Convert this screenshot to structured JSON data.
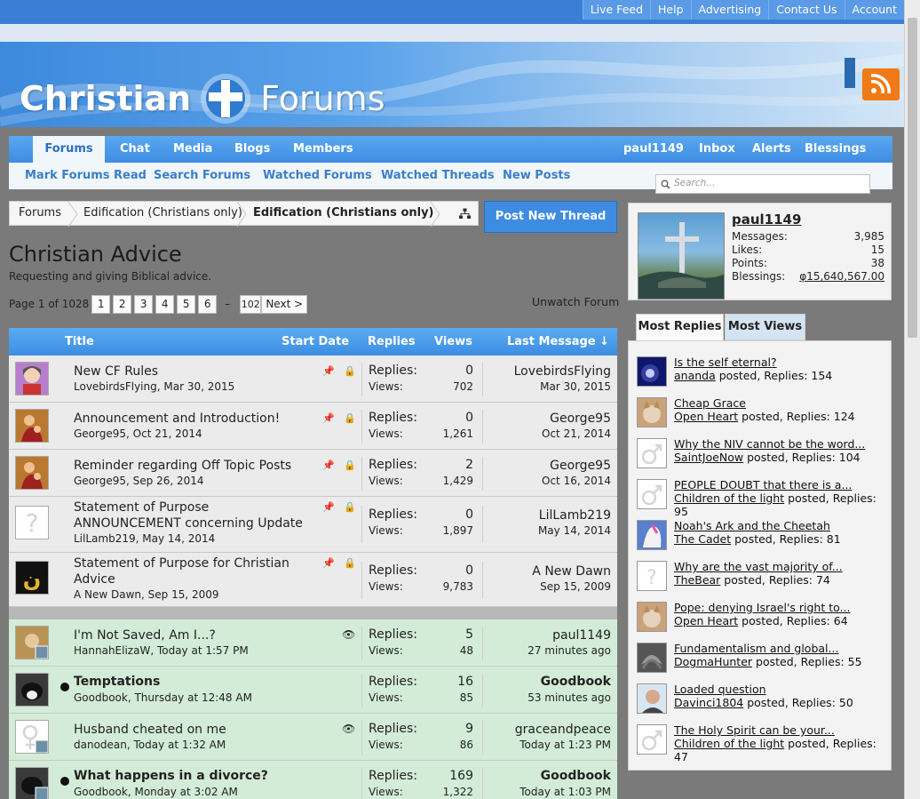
{
  "top_links": [
    "Live Feed",
    "Help",
    "Advertising",
    "Contact Us",
    "Account"
  ],
  "logo": {
    "word1": "Christian",
    "word2": "Forums"
  },
  "nav": {
    "tabs": [
      "Forums",
      "Chat",
      "Media",
      "Blogs",
      "Members"
    ],
    "user_links": [
      "paul1149",
      "Inbox",
      "Alerts",
      "Blessings"
    ]
  },
  "subnav": [
    "Mark Forums Read",
    "Search Forums",
    "Watched Forums",
    "Watched Threads",
    "New Posts"
  ],
  "search_placeholder": "Search...",
  "breadcrumb": [
    "Forums",
    "Edification (Christians only)",
    "Edification (Christians only)"
  ],
  "post_button": "Post New Thread",
  "forum": {
    "title": "Christian Advice",
    "description": "Requesting and giving Biblical advice."
  },
  "pager": {
    "label": "Page 1 of 1028",
    "pages": [
      "1",
      "2",
      "3",
      "4",
      "5",
      "6"
    ],
    "ellipsis": "–",
    "last": "102",
    "next": "Next >"
  },
  "unwatch": "Unwatch Forum",
  "table_header": {
    "title": "Title",
    "start_date": "Start Date",
    "replies": "Replies",
    "views": "Views",
    "last_message": "Last Message ↓"
  },
  "threads": [
    {
      "title": "New CF Rules",
      "starter": "LovebirdsFlying, Mar 30, 2015",
      "replies_label": "Replies:",
      "replies": "0",
      "views_label": "Views:",
      "views": "702",
      "last_user": "LovebirdsFlying",
      "last_date": "Mar 30, 2015"
    },
    {
      "title": "Announcement and Introduction!",
      "starter": "George95, Oct 21, 2014",
      "replies_label": "Replies:",
      "replies": "0",
      "views_label": "Views:",
      "views": "1,261",
      "last_user": "George95",
      "last_date": "Oct 21, 2014"
    },
    {
      "title": "Reminder regarding Off Topic Posts",
      "starter": "George95, Sep 26, 2014",
      "replies_label": "Replies:",
      "replies": "2",
      "views_label": "Views:",
      "views": "1,429",
      "last_user": "George95",
      "last_date": "Oct 16, 2014"
    },
    {
      "title_line1": "Statement of Purpose",
      "title_line2": "ANNOUNCEMENT concerning Update",
      "starter": "LilLamb219, May 14, 2014",
      "replies_label": "Replies:",
      "replies": "0",
      "views_label": "Views:",
      "views": "1,897",
      "last_user": "LilLamb219",
      "last_date": "May 14, 2014"
    },
    {
      "title_line1": "Statement of Purpose for Christian",
      "title_line2": "Advice",
      "starter": "A New Dawn, Sep 15, 2009",
      "replies_label": "Replies:",
      "replies": "0",
      "views_label": "Views:",
      "views": "9,783",
      "last_user": "A New Dawn",
      "last_date": "Sep 15, 2009"
    },
    {
      "title": "I'm Not Saved, Am I...?",
      "starter": "HannahElizaW, Today at 1:57 PM",
      "replies_label": "Replies:",
      "replies": "5",
      "views_label": "Views:",
      "views": "48",
      "last_user": "paul1149",
      "last_date": "27 minutes ago"
    },
    {
      "title": "Temptations",
      "starter": "Goodbook, Thursday at 12:48 AM",
      "replies_label": "Replies:",
      "replies": "16",
      "views_label": "Views:",
      "views": "85",
      "last_user": "Goodbook",
      "last_date": "53 minutes ago"
    },
    {
      "title": "Husband cheated on me",
      "starter": "danodean, Today at 1:32 AM",
      "replies_label": "Replies:",
      "replies": "9",
      "views_label": "Views:",
      "views": "86",
      "last_user": "graceandpeace",
      "last_date": "Today at 1:23 PM"
    },
    {
      "title": "What happens in a divorce?",
      "starter": "Goodbook, Monday at 3:02 AM",
      "replies_label": "Replies:",
      "replies": "169",
      "views_label": "Views:",
      "views": "1,322",
      "last_user": "Goodbook",
      "last_date": "Today at 1:03 PM"
    }
  ],
  "user_panel": {
    "name": "paul1149",
    "stats": [
      {
        "label": "Messages:",
        "value": "3,985"
      },
      {
        "label": "Likes:",
        "value": "15"
      },
      {
        "label": "Points:",
        "value": "38"
      },
      {
        "label": "Blessings:",
        "value": "φ15,640,567.00"
      }
    ]
  },
  "sidebar_tabs": [
    "Most Replies",
    "Most Views"
  ],
  "most_replies": [
    {
      "title": "Is the self eternal?",
      "user": "ananda",
      "text": " posted, Replies: 154"
    },
    {
      "title": "Cheap Grace",
      "user": "Open Heart",
      "text": " posted, Replies: 124"
    },
    {
      "title": "Why the NIV cannot be the word...",
      "user": "SaintJoeNow",
      "text": " posted, Replies: 104"
    },
    {
      "title": "PEOPLE DOUBT that there is a...",
      "user": "Children of the light",
      "text": " posted, Replies: 95"
    },
    {
      "title": "Noah's Ark and the Cheetah",
      "user": "The Cadet",
      "text": " posted, Replies: 81"
    },
    {
      "title": "Why are the vast majority of...",
      "user": "TheBear",
      "text": " posted, Replies: 74"
    },
    {
      "title": "Pope: denying Israel's right to...",
      "user": "Open Heart",
      "text": " posted, Replies: 64"
    },
    {
      "title": "Fundamentalism and global...",
      "user": "DogmaHunter",
      "text": " posted, Replies: 55"
    },
    {
      "title": "Loaded question",
      "user": "Davinci1804",
      "text": " posted, Replies: 50"
    },
    {
      "title": "The Holy Spirit can be your...",
      "user": "Children of the light",
      "text": " posted, Replies: 47"
    }
  ]
}
